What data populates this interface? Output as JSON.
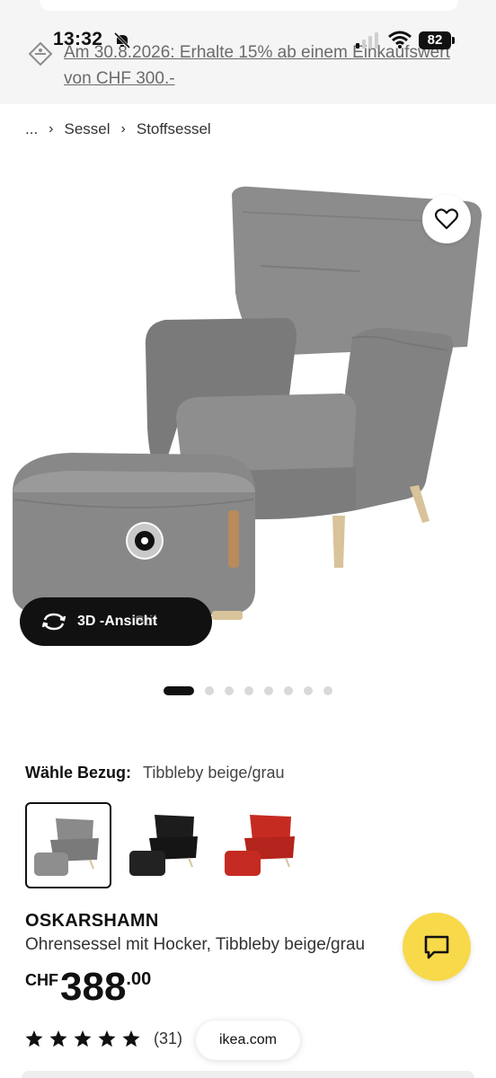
{
  "status_bar": {
    "time": "13:32",
    "battery": "82"
  },
  "promo": {
    "text": "Am 30.8.2026: Erhalte 15% ab einem Einkaufswert von CHF 300.-"
  },
  "breadcrumb": {
    "ellipsis": "...",
    "items": [
      "Sessel",
      "Stoffsessel"
    ]
  },
  "gallery": {
    "button_3d": "3D -Ansicht",
    "ghost_text": "Stil",
    "dot_count": 8,
    "active_dot": 0
  },
  "variant": {
    "label": "Wähle Bezug:",
    "value": "Tibbleby beige/grau",
    "swatches": [
      {
        "name": "grau",
        "color": "#8a8a8a",
        "selected": true
      },
      {
        "name": "schwarz",
        "color": "#1c1c1c",
        "selected": false
      },
      {
        "name": "rot",
        "color": "#c62b22",
        "selected": false
      }
    ]
  },
  "product": {
    "name": "OSKARSHAMN",
    "description": "Ohrensessel mit Hocker, Tibbleby beige/grau",
    "currency": "CHF",
    "price_main": "388",
    "price_decimals": ".00",
    "rating": 5,
    "review_count": "(31)"
  },
  "browser": {
    "url": "ikea.com"
  },
  "colors": {
    "chat_fab": "#f7d94a",
    "accent": "#111111",
    "fabric": "#8a8a8a"
  }
}
